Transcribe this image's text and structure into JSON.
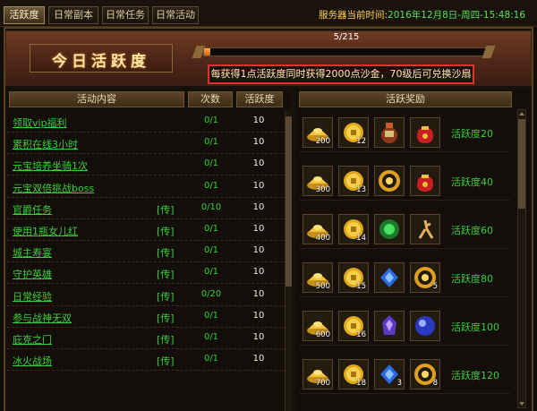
{
  "tabs": [
    {
      "label": "活跃度",
      "active": true
    },
    {
      "label": "日常副本",
      "active": false
    },
    {
      "label": "日常任务",
      "active": false
    },
    {
      "label": "日常活动",
      "active": false
    }
  ],
  "server": {
    "label": "服务器当前时间:",
    "time": "2016年12月8日-周四-15:48:16"
  },
  "banner": {
    "title": "今日活跃度",
    "progress_text": "5/215",
    "progress_current": 5,
    "progress_max": 215,
    "note": "每获得1点活跃度同时获得2000点沙金，70级后可兑换沙扇"
  },
  "table": {
    "headers": {
      "activity": "活动内容",
      "count": "次数",
      "points": "活跃度"
    },
    "rows": [
      {
        "name": "领取vip福利",
        "send": "",
        "count": "0/1",
        "points": "10"
      },
      {
        "name": "累积在线3小时",
        "send": "",
        "count": "0/1",
        "points": "10"
      },
      {
        "name": "元宝培养坐骑1次",
        "send": "",
        "count": "0/1",
        "points": "10"
      },
      {
        "name": "元宝双倍挑战boss",
        "send": "",
        "count": "0/1",
        "points": "10"
      },
      {
        "name": "官爵任务",
        "send": "[传]",
        "count": "0/10",
        "points": "10"
      },
      {
        "name": "使用1瓶女儿红",
        "send": "[传]",
        "count": "0/1",
        "points": "10"
      },
      {
        "name": "城主寿宴",
        "send": "[传]",
        "count": "0/1",
        "points": "10"
      },
      {
        "name": "守护英雄",
        "send": "[传]",
        "count": "0/1",
        "points": "10"
      },
      {
        "name": "日常经验",
        "send": "[传]",
        "count": "0/20",
        "points": "10"
      },
      {
        "name": "参与战神无双",
        "send": "[传]",
        "count": "0/1",
        "points": "10"
      },
      {
        "name": "庇克之门",
        "send": "[传]",
        "count": "0/1",
        "points": "10"
      },
      {
        "name": "冰火战场",
        "send": "[传]",
        "count": "0/1",
        "points": "10"
      }
    ]
  },
  "rewards": {
    "header": "活跃奖励",
    "rows": [
      {
        "label": "活跃度20",
        "items": [
          {
            "icon": "gold-ingot-icon",
            "qty": "200"
          },
          {
            "icon": "coin-icon",
            "qty": "12"
          },
          {
            "icon": "wine-jar-icon",
            "qty": ""
          },
          {
            "icon": "red-pouch-icon",
            "qty": ""
          }
        ]
      },
      {
        "label": "活跃度40",
        "items": [
          {
            "icon": "gold-ingot-icon",
            "qty": "300"
          },
          {
            "icon": "coin-icon",
            "qty": "13"
          },
          {
            "icon": "gold-bracelet-icon",
            "qty": ""
          },
          {
            "icon": "red-pouch-icon",
            "qty": ""
          }
        ]
      },
      {
        "label": "活跃度60",
        "items": [
          {
            "icon": "gold-ingot-icon",
            "qty": "400"
          },
          {
            "icon": "coin-icon",
            "qty": "14"
          },
          {
            "icon": "green-orb-icon",
            "qty": ""
          },
          {
            "icon": "herb-root-icon",
            "qty": ""
          }
        ]
      },
      {
        "label": "活跃度80",
        "items": [
          {
            "icon": "gold-ingot-icon",
            "qty": "500"
          },
          {
            "icon": "coin-icon",
            "qty": "15"
          },
          {
            "icon": "blue-gem-icon",
            "qty": ""
          },
          {
            "icon": "gold-bracelet-icon",
            "qty": "5"
          }
        ]
      },
      {
        "label": "活跃度100",
        "items": [
          {
            "icon": "gold-ingot-icon",
            "qty": "600"
          },
          {
            "icon": "coin-icon",
            "qty": "16"
          },
          {
            "icon": "purple-gem-icon",
            "qty": ""
          },
          {
            "icon": "blue-pearl-icon",
            "qty": ""
          }
        ]
      },
      {
        "label": "活跃度120",
        "items": [
          {
            "icon": "gold-ingot-icon",
            "qty": "700"
          },
          {
            "icon": "coin-icon",
            "qty": "18"
          },
          {
            "icon": "blue-gem-icon",
            "qty": "3"
          },
          {
            "icon": "gold-bracelet-icon",
            "qty": "8"
          }
        ]
      }
    ]
  }
}
